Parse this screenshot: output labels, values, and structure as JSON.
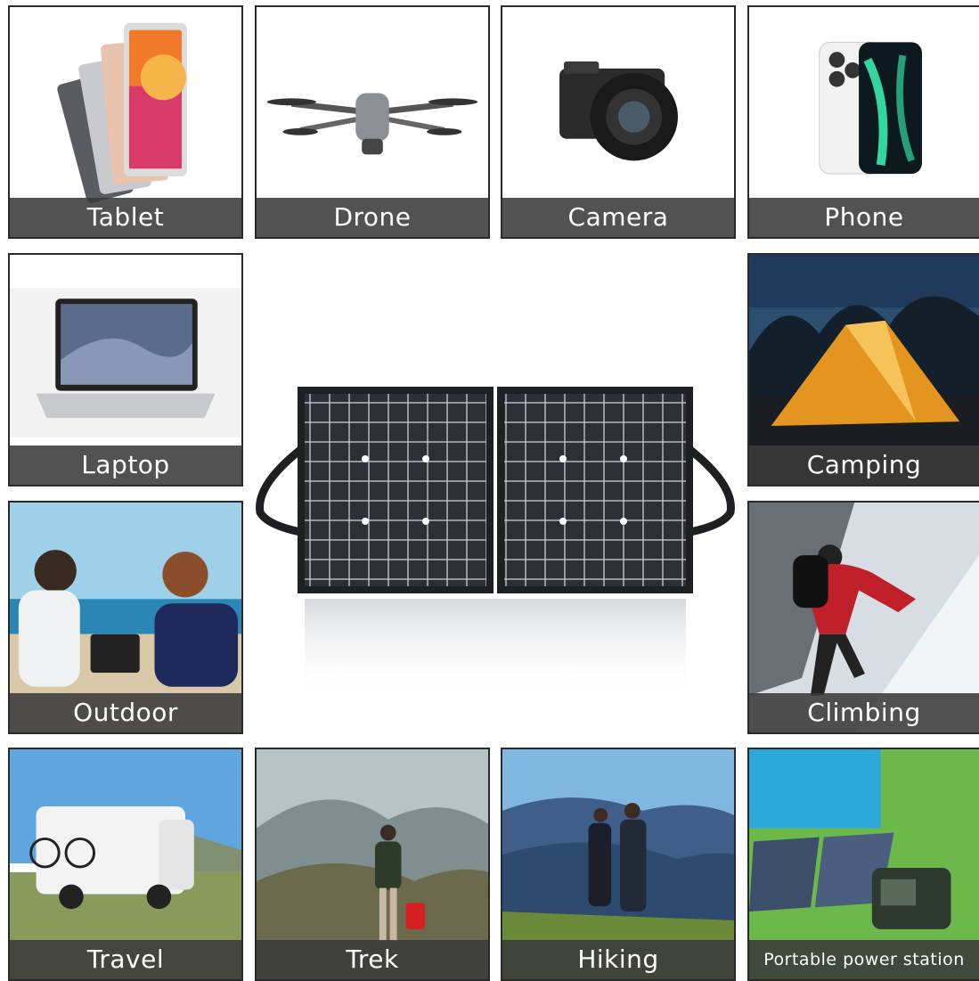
{
  "tiles": {
    "tablet": "Tablet",
    "drone": "Drone",
    "camera": "Camera",
    "phone": "Phone",
    "laptop": "Laptop",
    "camping": "Camping",
    "outdoor": "Outdoor",
    "climbing": "Climbing",
    "travel": "Travel",
    "trek": "Trek",
    "hiking": "Hiking",
    "portable_power_station": "Portable power station"
  },
  "colors": {
    "caption_bg": "#3a3a3a",
    "border": "#2a2a2a",
    "panel": "#1f2024"
  },
  "icons": [
    "tablet-image",
    "drone-image",
    "camera-image",
    "phone-image",
    "laptop-image",
    "tent-image",
    "people-laptop-image",
    "climber-image",
    "rv-image",
    "trekker-image",
    "hikers-image",
    "power-station-image",
    "solar-panel-image"
  ]
}
